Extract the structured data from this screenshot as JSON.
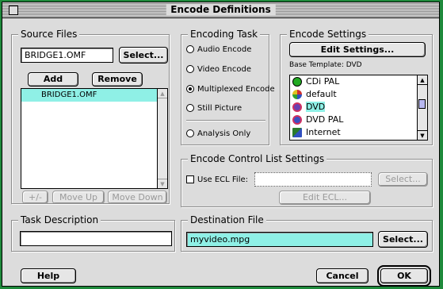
{
  "window": {
    "title": "Encode Definitions"
  },
  "source_files": {
    "label": "Source Files",
    "input_value": "BRIDGE1.OMF",
    "select_label": "Select...",
    "add_label": "Add",
    "remove_label": "Remove",
    "items": [
      "BRIDGE1.OMF"
    ],
    "plus_minus_label": "+/-",
    "move_up_label": "Move Up",
    "move_down_label": "Move Down"
  },
  "encoding_task": {
    "label": "Encoding Task",
    "options": [
      "Audio Encode",
      "Video Encode",
      "Multiplexed Encode",
      "Still Picture",
      "Analysis Only"
    ],
    "selected": "Multiplexed Encode"
  },
  "encode_settings": {
    "label": "Encode Settings",
    "edit_label": "Edit Settings...",
    "base_template": "Base Template: DVD",
    "items": [
      {
        "label": "CDi PAL",
        "color": "#22aa22"
      },
      {
        "label": "default",
        "color": "#6a3fb0"
      },
      {
        "label": "DVD",
        "color": "#d03060"
      },
      {
        "label": "DVD PAL",
        "color": "#3c4fc0"
      },
      {
        "label": "Internet",
        "color": "#2a7a2a"
      }
    ],
    "selected": "DVD"
  },
  "ecl": {
    "label": "Encode Control List Settings",
    "use_label": "Use ECL File:",
    "file_value": "",
    "select_label": "Select...",
    "edit_label": "Edit ECL..."
  },
  "task_description": {
    "label": "Task Description",
    "value": ""
  },
  "destination": {
    "label": "Destination File",
    "value": "myvideo.mpg",
    "select_label": "Select..."
  },
  "footer": {
    "help_label": "Help",
    "cancel_label": "Cancel",
    "ok_label": "OK"
  },
  "colors": {
    "desktop": "#1f8a3c",
    "highlight": "#8ff0e6",
    "window": "#dcdcdc"
  }
}
